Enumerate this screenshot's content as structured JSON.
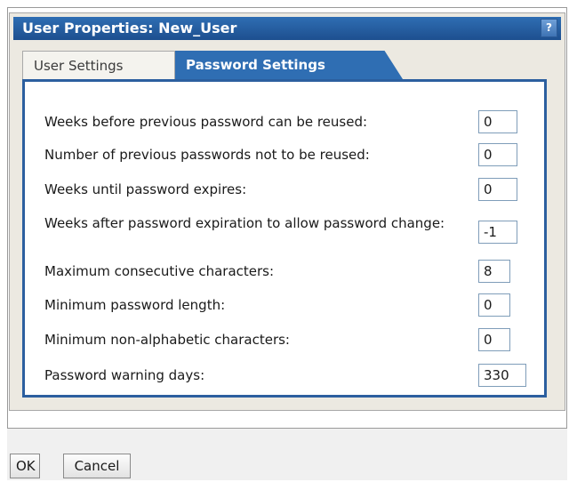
{
  "dialog": {
    "title": "User Properties: New_User",
    "help_label": "?"
  },
  "tabs": [
    {
      "label": "User Settings",
      "active": false
    },
    {
      "label": "Password Settings",
      "active": true
    }
  ],
  "fields": [
    {
      "label": "Weeks before previous password can be reused:",
      "value": "0"
    },
    {
      "label": "Number of previous passwords not to be reused:",
      "value": "0"
    },
    {
      "label": "Weeks until password expires:",
      "value": "0"
    },
    {
      "label": "Weeks after password expiration to allow password change:",
      "value": "-1"
    },
    {
      "label": "Maximum consecutive characters:",
      "value": "8"
    },
    {
      "label": "Minimum password length:",
      "value": "0"
    },
    {
      "label": "Minimum non-alphabetic characters:",
      "value": "0"
    },
    {
      "label": "Password warning days:",
      "value": "330"
    }
  ],
  "buttons": {
    "ok_label": "OK",
    "cancel_label": "Cancel"
  },
  "colors": {
    "title_bar": "#1d4f8f",
    "active_tab": "#2f6eb3",
    "panel_border": "#2c5f9f"
  }
}
